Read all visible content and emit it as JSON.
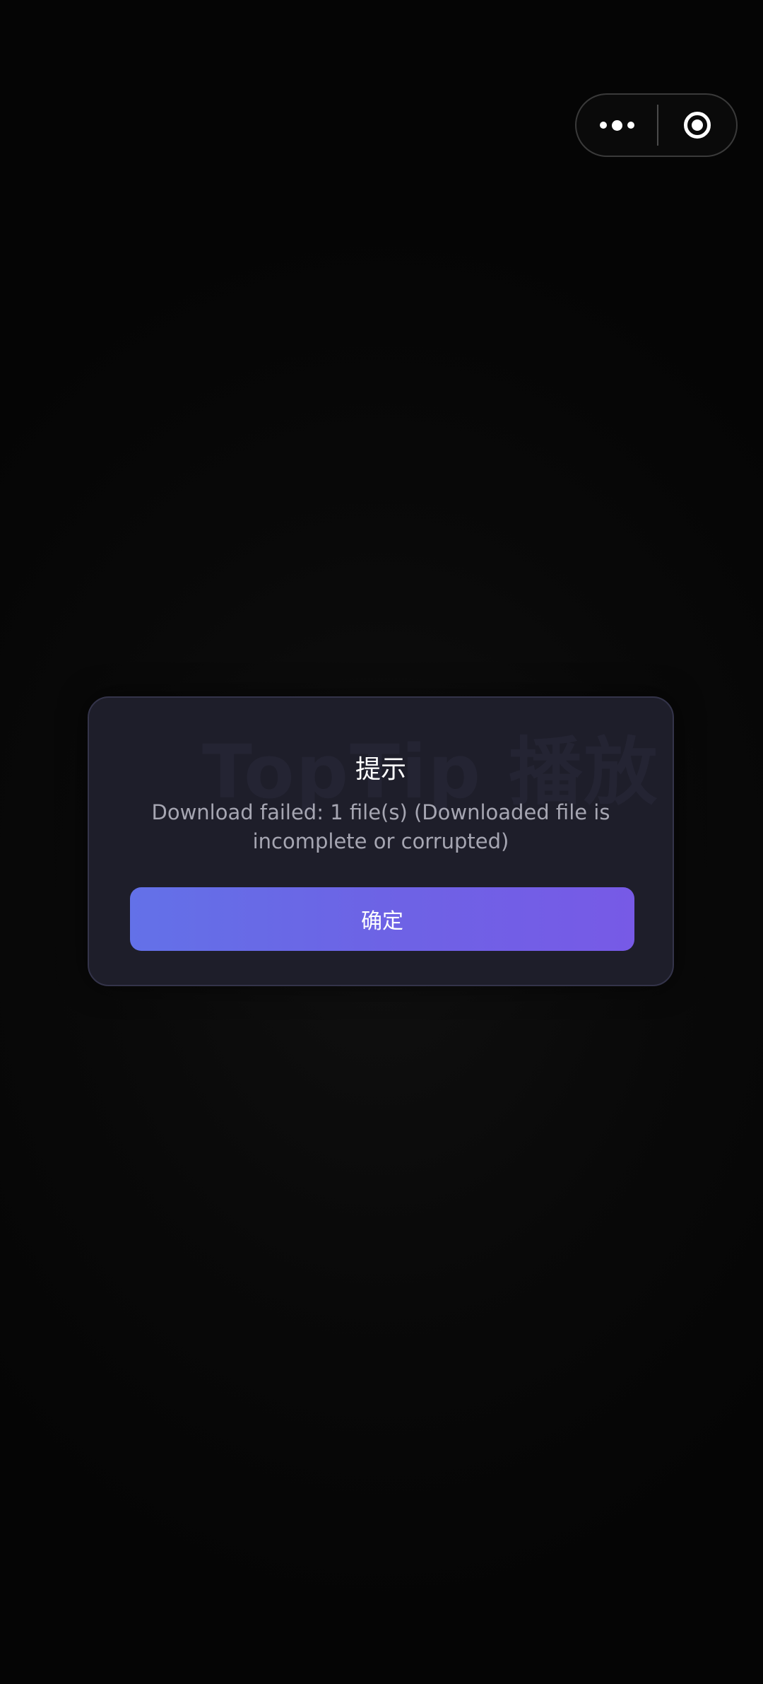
{
  "capsule": {
    "more_icon": "more-dots-icon",
    "close_icon": "target-circle-icon"
  },
  "dialog": {
    "watermark": "TopTip 播放",
    "title": "提示",
    "message": "Download failed: 1 file(s) (Downloaded file is incomplete or corrupted)",
    "confirm_label": "确定"
  },
  "colors": {
    "background": "#050505",
    "dialog_bg": "#1e1e2a",
    "button_gradient_start": "#6371e8",
    "button_gradient_end": "#775ae6",
    "message_text": "#a6a6b2"
  }
}
